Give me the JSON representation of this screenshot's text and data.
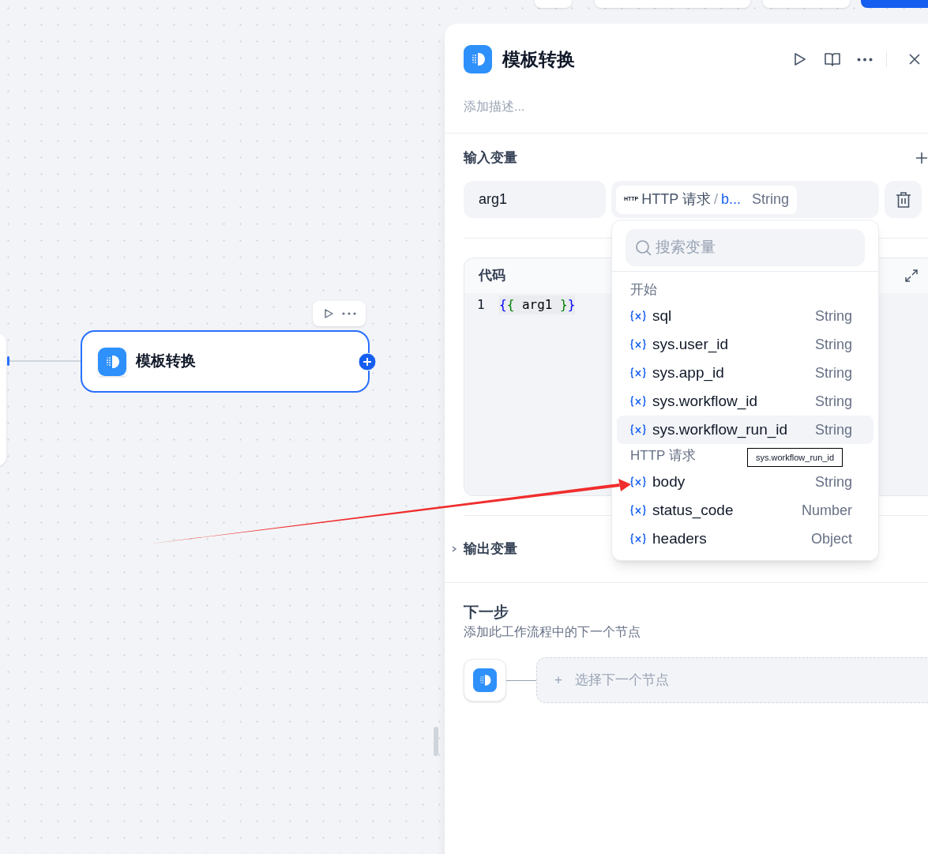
{
  "canvas": {
    "node": {
      "title": "模板转换",
      "selected": true
    }
  },
  "panel": {
    "title": "模板转换",
    "description_placeholder": "添加描述...",
    "inputs": {
      "title": "输入变量",
      "variables": [
        {
          "name": "arg1",
          "source_badge": "HTTP",
          "source_node": "HTTP 请求",
          "separator": "/",
          "variable": "b...",
          "type": "String"
        }
      ]
    },
    "code": {
      "title": "代码",
      "lines": [
        {
          "number": "1",
          "tokens": [
            {
              "text": "{",
              "color": "#0000ff"
            },
            {
              "text": "{",
              "color": "#008000"
            },
            {
              "text": " arg1 ",
              "color": "#000000"
            },
            {
              "text": "}",
              "color": "#008000"
            },
            {
              "text": "}",
              "color": "#0000ff"
            }
          ]
        }
      ]
    },
    "outputs": {
      "title": "输出变量",
      "expanded": false
    },
    "next_step": {
      "title": "下一步",
      "description": "添加此工作流程中的下一个节点",
      "placeholder": "选择下一个节点",
      "plus": "+"
    }
  },
  "variable_dropdown": {
    "search_placeholder": "搜索变量",
    "groups": [
      {
        "title": "开始",
        "items": [
          {
            "name": "sql",
            "type": "String",
            "selected": false
          },
          {
            "name": "sys.user_id",
            "type": "String",
            "selected": false
          },
          {
            "name": "sys.app_id",
            "type": "String",
            "selected": false
          },
          {
            "name": "sys.workflow_id",
            "type": "String",
            "selected": false
          },
          {
            "name": "sys.workflow_run_id",
            "type": "String",
            "selected": true
          }
        ]
      },
      {
        "title": "HTTP 请求",
        "items": [
          {
            "name": "body",
            "type": "String",
            "selected": false
          },
          {
            "name": "status_code",
            "type": "Number",
            "selected": false
          },
          {
            "name": "headers",
            "type": "Object",
            "selected": false
          }
        ]
      }
    ],
    "tooltip": "sys.workflow_run_id"
  }
}
